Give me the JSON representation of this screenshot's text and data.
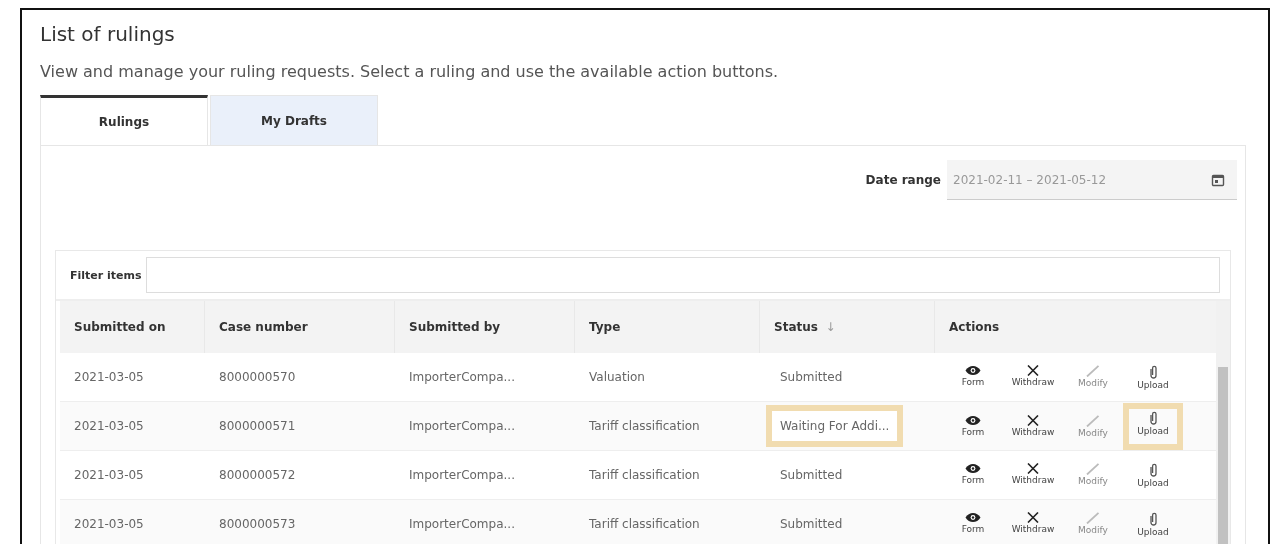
{
  "page": {
    "title": "List of rulings",
    "description": "View and manage your ruling requests. Select a ruling and use the available action buttons."
  },
  "tabs": [
    {
      "label": "Rulings",
      "selected": true
    },
    {
      "label": "My Drafts",
      "selected": false
    }
  ],
  "date_range": {
    "label": "Date range",
    "value": "2021-02-11 – 2021-05-12"
  },
  "filter": {
    "label": "Filter items"
  },
  "table": {
    "columns": [
      {
        "label": "Submitted on"
      },
      {
        "label": "Case number"
      },
      {
        "label": "Submitted by"
      },
      {
        "label": "Type"
      },
      {
        "label": "Status",
        "sort": "↓"
      },
      {
        "label": "Actions"
      }
    ],
    "rows": [
      {
        "submitted_on": "2021-03-05",
        "case_number": "8000000570",
        "submitted_by": "ImporterCompa...",
        "type": "Valuation",
        "status": "Submitted",
        "highlighted": false,
        "actions": [
          {
            "kind": "form",
            "label": "Form",
            "disabled": false
          },
          {
            "kind": "withdraw",
            "label": "Withdraw",
            "disabled": false
          },
          {
            "kind": "modify",
            "label": "Modify",
            "disabled": true
          },
          {
            "kind": "upload",
            "label": "Upload",
            "disabled": false
          }
        ]
      },
      {
        "submitted_on": "2021-03-05",
        "case_number": "8000000571",
        "submitted_by": "ImporterCompa...",
        "type": "Tariff classification",
        "status": "Waiting For Addi...",
        "highlighted": true,
        "actions": [
          {
            "kind": "form",
            "label": "Form",
            "disabled": false
          },
          {
            "kind": "withdraw",
            "label": "Withdraw",
            "disabled": false
          },
          {
            "kind": "modify",
            "label": "Modify",
            "disabled": true
          },
          {
            "kind": "upload",
            "label": "Upload",
            "disabled": false
          }
        ]
      },
      {
        "submitted_on": "2021-03-05",
        "case_number": "8000000572",
        "submitted_by": "ImporterCompa...",
        "type": "Tariff classification",
        "status": "Submitted",
        "highlighted": false,
        "actions": [
          {
            "kind": "form",
            "label": "Form",
            "disabled": false
          },
          {
            "kind": "withdraw",
            "label": "Withdraw",
            "disabled": false
          },
          {
            "kind": "modify",
            "label": "Modify",
            "disabled": true
          },
          {
            "kind": "upload",
            "label": "Upload",
            "disabled": false
          }
        ]
      },
      {
        "submitted_on": "2021-03-05",
        "case_number": "8000000573",
        "submitted_by": "ImporterCompa...",
        "type": "Tariff classification",
        "status": "Submitted",
        "highlighted": false,
        "actions": [
          {
            "kind": "form",
            "label": "Form",
            "disabled": false
          },
          {
            "kind": "withdraw",
            "label": "Withdraw",
            "disabled": false
          },
          {
            "kind": "modify",
            "label": "Modify",
            "disabled": true
          },
          {
            "kind": "upload",
            "label": "Upload",
            "disabled": false
          }
        ]
      }
    ]
  }
}
